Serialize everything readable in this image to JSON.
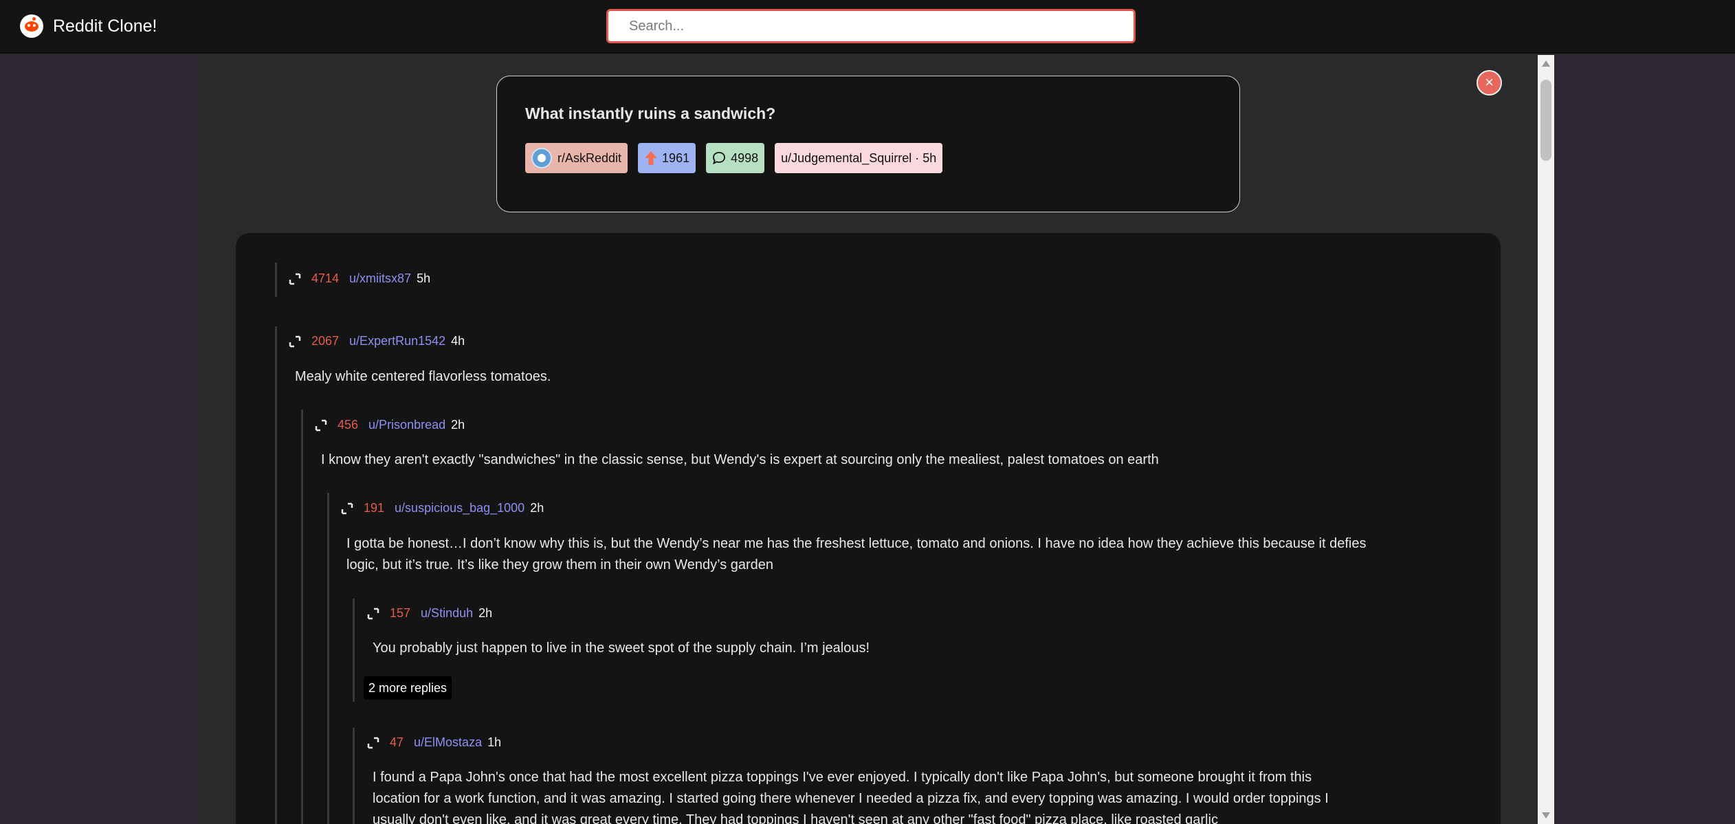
{
  "app": {
    "title": "Reddit Clone!"
  },
  "search": {
    "placeholder": "Search..."
  },
  "close": {
    "label": "×"
  },
  "post": {
    "title": "What instantly ruins a sandwich?",
    "subreddit": "r/AskReddit",
    "votes": "1961",
    "comments": "4998",
    "author_age": "u/Judgemental_Squirrel · 5h"
  },
  "comments": [
    {
      "score": "4714",
      "user": "u/xmiitsx87",
      "age": "5h",
      "text": ""
    },
    {
      "score": "2067",
      "user": "u/ExpertRun1542",
      "age": "4h",
      "text": "Mealy white centered flavorless tomatoes."
    },
    {
      "score": "456",
      "user": "u/Prisonbread",
      "age": "2h",
      "text": "I know they aren't exactly \"sandwiches\" in the classic sense, but Wendy's is expert at sourcing only the mealiest, palest tomatoes on earth"
    },
    {
      "score": "191",
      "user": "u/suspicious_bag_1000",
      "age": "2h",
      "text": "I gotta be honest…I don’t know why this is, but the Wendy’s near me has the freshest lettuce, tomato and onions. I have no idea how they achieve this because it defies logic, but it’s true. It’s like they grow them in their own Wendy’s garden"
    },
    {
      "score": "157",
      "user": "u/Stinduh",
      "age": "2h",
      "text": "You probably just happen to live in the sweet spot of the supply chain. I’m jealous!",
      "more": "2 more replies"
    },
    {
      "score": "47",
      "user": "u/ElMostaza",
      "age": "1h",
      "text": "I found a Papa John's once that had the most excellent pizza toppings I've ever enjoyed. I typically don't like Papa John's, but someone brought it from this location for a work function, and it was amazing. I started going there whenever I needed a pizza fix, and every topping was amazing. I would order toppings I usually don't even like, and it was great every time. They had toppings I haven't seen at any other \"fast food\" pizza place, like roasted garlic"
    }
  ]
}
